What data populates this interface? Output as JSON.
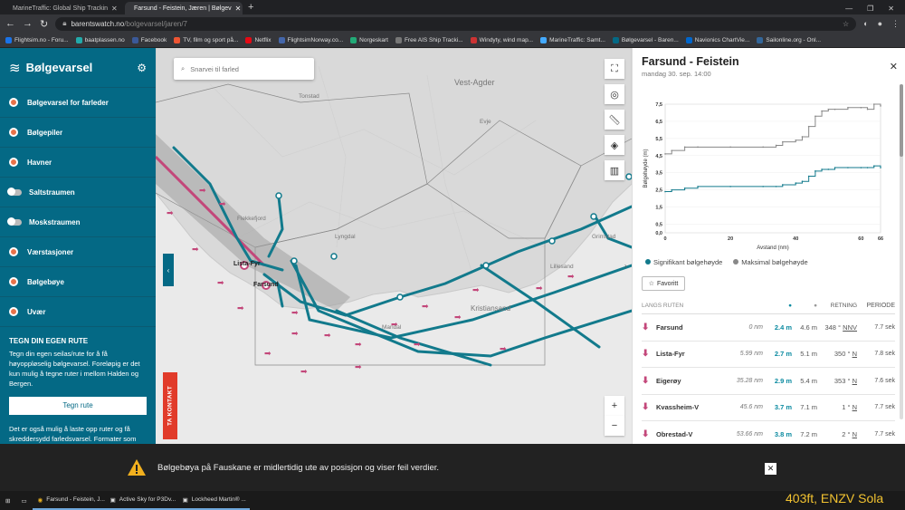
{
  "browser": {
    "tabs": [
      {
        "title": "MarineTraffic: Global Ship Trackin",
        "active": false
      },
      {
        "title": "Farsund - Feistein, Jæren | Bølgev",
        "active": true
      }
    ],
    "url_host": "barentswatch.no",
    "url_path": "/bolgevarsel/jaren/7",
    "bookmarks": [
      "Flightsim.no - Foru...",
      "baatplassen.no",
      "Facebook",
      "TV, film og sport på...",
      "Netflix",
      "FlightsimNorway.co...",
      "Norgeskart",
      "Free AIS Ship Tracki...",
      "Windyty, wind map...",
      "MarineTraffic: Samt...",
      "Bølgevarsel - Baren...",
      "Navionics ChartVie...",
      "Sailonline.org - Onl..."
    ]
  },
  "sidebar": {
    "title": "Bølgevarsel",
    "items": [
      {
        "label": "Bølgevarsel for farleder",
        "kind": "dot"
      },
      {
        "label": "Bølgepiler",
        "kind": "dot"
      },
      {
        "label": "Havner",
        "kind": "dot"
      },
      {
        "label": "Saltstraumen",
        "kind": "toggle"
      },
      {
        "label": "Moskstraumen",
        "kind": "toggle"
      },
      {
        "label": "Værstasjoner",
        "kind": "dot"
      },
      {
        "label": "Bølgebøye",
        "kind": "dot"
      },
      {
        "label": "Uvær",
        "kind": "dot"
      }
    ],
    "route": {
      "heading": "TEGN DIN EGEN RUTE",
      "text": "Tegn din egen seilas/rute for å få høyoppløselig bølgevarsel. Foreløpig er det kun mulig å tegne ruter i mellom Halden og Bergen.",
      "button": "Tegn rute",
      "text2": "Det er også mulig å laste opp ruter og få skreddersydd farledsvarsel. Formater som"
    }
  },
  "map": {
    "search_placeholder": "Snarvei til farled",
    "labels": [
      "Vest-Agder",
      "Tonstad",
      "Evje",
      "Flekkefjord",
      "Lyngdal",
      "Lista-Fyr",
      "Farsund",
      "Mandal",
      "Kristiansand",
      "Lillesand",
      "Grimstad"
    ],
    "contact_label": "TA KONTAKT",
    "zoom_in": "+",
    "zoom_out": "−"
  },
  "detail": {
    "title": "Farsund - Feistein",
    "subtitle": "mandag 30. sep. 14:00",
    "legend": [
      "Signifikant bølgehøyde",
      "Maksimal bølgehøyde"
    ],
    "favorite_label": "Favoritt",
    "table_headers": [
      "LANGS RUTEN",
      "RETNING",
      "PERIODE"
    ],
    "rows": [
      {
        "name": "Farsund",
        "dist": "0 nm",
        "hs": "2.4 m",
        "hmax": "4.6 m",
        "dir_deg": "348 °",
        "dir": "NNV",
        "period": "7.7 sek"
      },
      {
        "name": "Lista-Fyr",
        "dist": "5.99 nm",
        "hs": "2.7 m",
        "hmax": "5.1 m",
        "dir_deg": "350 °",
        "dir": "N",
        "period": "7.8 sek"
      },
      {
        "name": "Eigerøy",
        "dist": "35.28 nm",
        "hs": "2.9 m",
        "hmax": "5.4 m",
        "dir_deg": "353 °",
        "dir": "N",
        "period": "7.6 sek"
      },
      {
        "name": "Kvassheim-V",
        "dist": "45.6 nm",
        "hs": "3.7 m",
        "hmax": "7.1 m",
        "dir_deg": "1 °",
        "dir": "N",
        "period": "7.7 sek"
      },
      {
        "name": "Obrestad-V",
        "dist": "53.66 nm",
        "hs": "3.8 m",
        "hmax": "7.2 m",
        "dir_deg": "2 °",
        "dir": "N",
        "period": "7.7 sek"
      }
    ]
  },
  "chart_data": {
    "type": "line",
    "xlabel": "Avstand (nm)",
    "ylabel": "Bølgehøyde (m)",
    "xlim": [
      0,
      66
    ],
    "ylim": [
      0,
      7.5
    ],
    "x_ticks": [
      "0",
      "20",
      "40",
      "60",
      "66"
    ],
    "y_ticks": [
      "0,0",
      "0,5",
      "1,0",
      "1,5",
      "2,0",
      "2,5",
      "3,0",
      "3,5",
      "4,0",
      "4,5",
      "5,0",
      "5,5",
      "6,0",
      "6,5",
      "7,0",
      "7,5"
    ],
    "series": [
      {
        "name": "Maksimal bølgehøyde",
        "color": "#888888",
        "x": [
          0,
          2,
          6,
          10,
          20,
          30,
          34,
          36,
          40,
          42,
          44,
          46,
          48,
          50,
          52,
          56,
          60,
          62,
          64,
          66
        ],
        "values": [
          4.6,
          4.8,
          5.0,
          5.0,
          5.0,
          5.0,
          5.1,
          5.3,
          5.4,
          5.6,
          6.2,
          6.8,
          7.1,
          7.2,
          7.2,
          7.3,
          7.3,
          7.2,
          7.5,
          7.4
        ]
      },
      {
        "name": "Signifikant bølgehøyde",
        "color": "#127a8c",
        "x": [
          0,
          2,
          6,
          10,
          20,
          30,
          34,
          36,
          40,
          42,
          44,
          46,
          48,
          50,
          52,
          56,
          60,
          62,
          64,
          66
        ],
        "values": [
          2.4,
          2.5,
          2.6,
          2.7,
          2.7,
          2.7,
          2.7,
          2.8,
          2.9,
          3.0,
          3.3,
          3.6,
          3.7,
          3.7,
          3.8,
          3.8,
          3.8,
          3.8,
          3.9,
          3.8
        ]
      }
    ]
  },
  "toast": {
    "message": "Bølgebøya på Fauskane er midlertidig ute av posisjon og viser feil verdier."
  },
  "taskbar": {
    "apps": [
      "Farsund - Feistein, J...",
      "Active Sky for P3Dv...",
      "Lockheed Martin® ..."
    ]
  },
  "overlay_text": "403ft, ENZV Sola",
  "colors": {
    "sidebar": "#046985",
    "route": "#127a8c",
    "accent": "#e13b2a",
    "arrow": "#c3477a"
  }
}
